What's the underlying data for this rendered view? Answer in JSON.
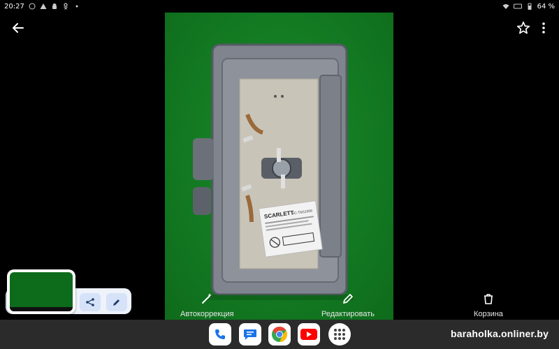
{
  "status_bar": {
    "time": "20:27",
    "battery": "64 %"
  },
  "actions": {
    "auto_label": "Автокоррекция",
    "edit_label": "Редактировать",
    "trash_label": "Корзина"
  },
  "photo_text": {
    "brand": "SCARLETT",
    "model": "SC-TM11008"
  },
  "watermark": "baraholka.onliner.by",
  "colors": {
    "background": "#000000",
    "photo_green": "#137a22",
    "panel": "#eef2fb",
    "taskbar": "#2b2b2b"
  },
  "icons": {
    "back": "arrow-left-icon",
    "star": "star-icon",
    "more": "more-vert-icon",
    "auto": "magic-wand-icon",
    "edit": "pencil-icon",
    "trash": "trash-icon",
    "share": "share-icon"
  }
}
